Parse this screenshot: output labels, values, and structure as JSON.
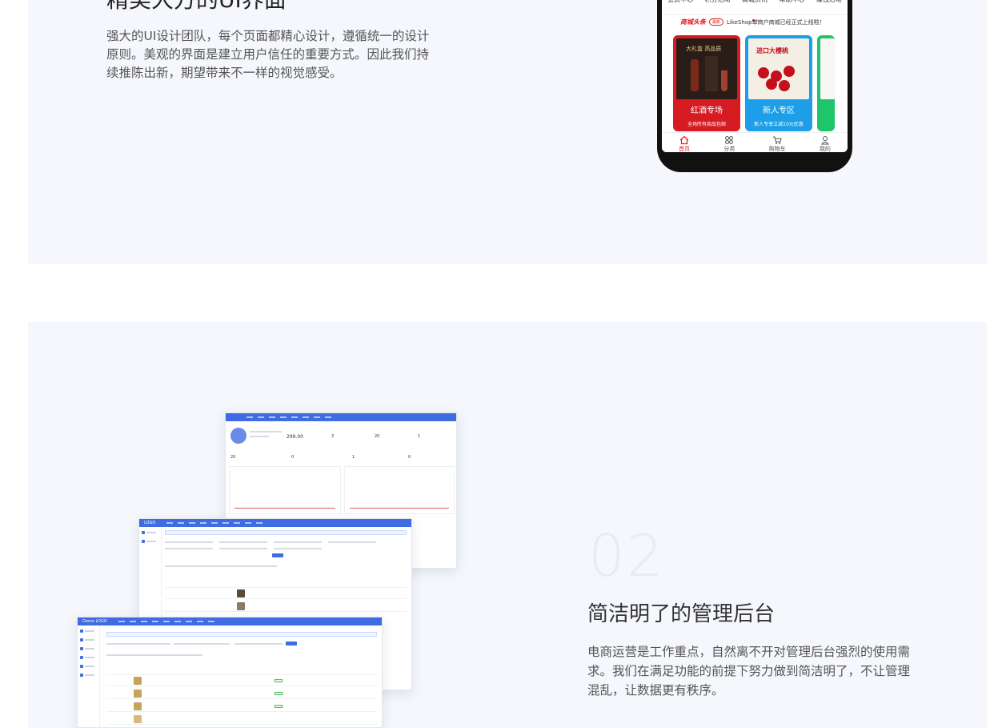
{
  "section1": {
    "title": "精美大方的UI界面",
    "description": "强大的UI设计团队，每个页面都精心设计，遵循统一的设计原则。美观的界面是建立用户信任的重要方式。因此我们持续推陈出新，期望带来不一样的视觉感受。"
  },
  "phone": {
    "top_nav": [
      "会员中心",
      "积分活动",
      "商城资讯",
      "帮助中心",
      "赚钱活动"
    ],
    "headline_brand": "商城头条",
    "headline_tag": "最新",
    "headline_text": "LikeShop单商户商城已经正式上线啦！",
    "cards": [
      {
        "label": "红酒专场",
        "sub": "全场所有商品包邮",
        "color": "red",
        "img_text": "大礼盒 高品质"
      },
      {
        "label": "新人专区",
        "sub": "新人专享立减10元优惠",
        "color": "blue",
        "img_text": "进口大樱桃"
      },
      {
        "label": "",
        "sub": "",
        "color": "green",
        "img_text": ""
      }
    ],
    "bottom_nav": [
      {
        "label": "首页",
        "icon": "home-icon",
        "active": true
      },
      {
        "label": "分类",
        "icon": "category-icon",
        "active": false
      },
      {
        "label": "购物车",
        "icon": "cart-icon",
        "active": false
      },
      {
        "label": "我的",
        "icon": "user-icon",
        "active": false
      }
    ]
  },
  "section2": {
    "number": "02",
    "title": "简洁明了的管理后台",
    "description": "电商运营是工作重点，自然离不开对管理后台强烈的使用需求。我们在满足功能的前提下努力做到简洁明了，不让管理混乱，让数据更有秩序。"
  },
  "admin_shots": {
    "dashboard_value": "299.00",
    "dashboard_stats": [
      "3",
      "20",
      "1"
    ],
    "dashboard_stats2": [
      "20",
      "0",
      "1",
      "0"
    ],
    "mid_logo": "LOGO",
    "front_logo": "Demo LOGO"
  },
  "colors": {
    "accent_red": "#e61a1a",
    "admin_blue": "#3f6ce2",
    "panel_bg": "#f5f7fc"
  }
}
